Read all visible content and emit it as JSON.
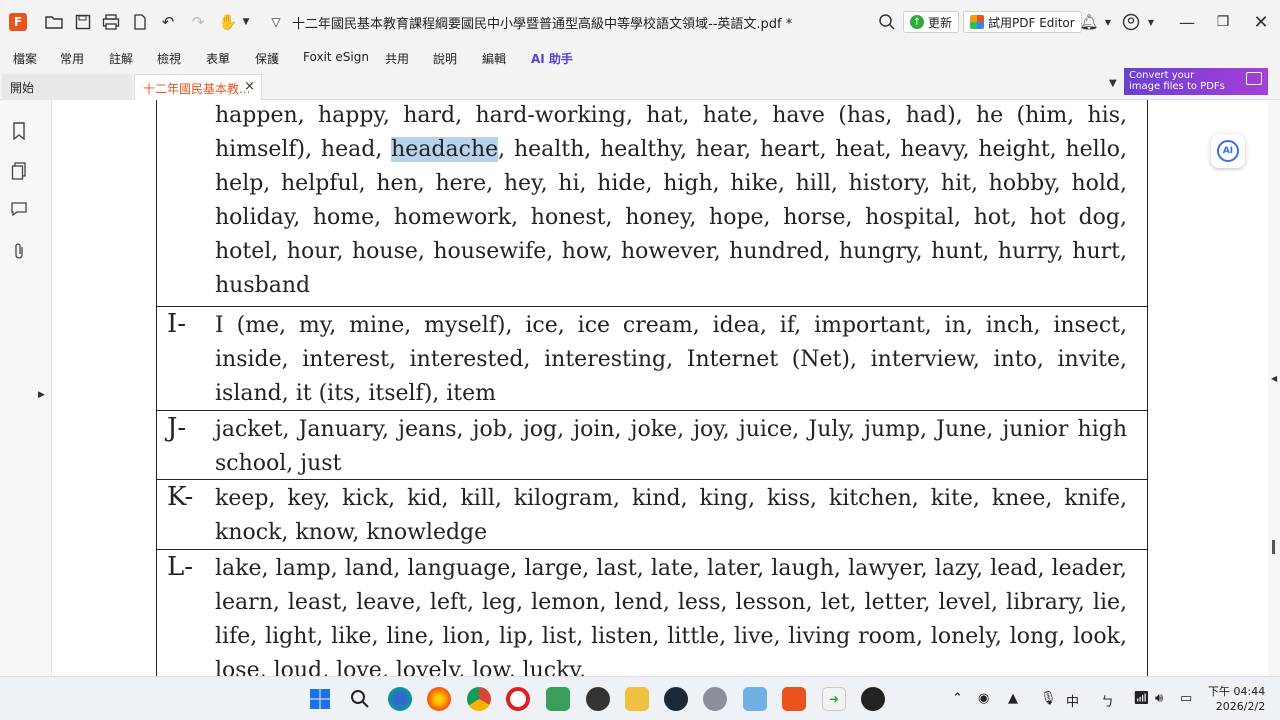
{
  "app": {
    "logo_glyph": "F",
    "document_title": "十二年國民基本教育課程綱要國民中小學暨普通型高級中等學校語文領域--英語文.pdf *",
    "update_label": "更新",
    "try_editor_label": "試用PDF Editor"
  },
  "menu": {
    "items": [
      "檔案",
      "常用",
      "註解",
      "檢視",
      "表單",
      "保護",
      "Foxit eSign",
      "共用",
      "說明",
      "編輯",
      "AI 助手"
    ]
  },
  "tabs": {
    "home_label": "開始",
    "doc_label": "十二年國民基本教...",
    "close_glyph": "×"
  },
  "promo": {
    "line1": "Convert your",
    "line2": "image files to PDFs"
  },
  "vocab": {
    "rows": [
      {
        "letter": "",
        "pre_highlight": "happen, happy, hard, hard-working, hat, hate, have (has, had), he (him, his, himself), head, ",
        "highlight": "headache",
        "post_highlight": ", health, healthy, hear, heart, heat, heavy, height, hello, help, helpful, hen, here, hey, hi, hide, high, hike, hill, history, hit, hobby, hold, holiday, home, homework, honest, honey, hope, horse, hospital, hot, hot dog, hotel, hour, house, housewife, how, however, hundred, hungry, hunt, hurry, hurt, husband"
      },
      {
        "letter": "I-",
        "text": "I (me, my, mine, myself), ice, ice cream, idea, if, important, in, inch, insect, inside, interest, interested, interesting, Internet (Net), interview, into, invite, island, it (its, itself), item"
      },
      {
        "letter": "J-",
        "text": "jacket, January, jeans, job, jog, join, joke, joy, juice, July, jump, June, junior high school, just"
      },
      {
        "letter": "K-",
        "text": "keep, key, kick, kid, kill, kilogram, kind, king, kiss, kitchen, kite, knee, knife, knock, know, knowledge"
      },
      {
        "letter": "L-",
        "text": "lake, lamp, land, language, large, last, late, later, laugh, lawyer, lazy, lead, leader, learn, least, leave, left, leg, lemon, lend, less, lesson, let, letter, level, library, lie, life, light, like, line, lion, lip, list, listen, little, live, living room, lonely, long, look, lose, loud, love, lovely, low, lucky,"
      }
    ]
  },
  "ai_float_label": "AI",
  "taskbar": {
    "ime_label": "中",
    "clock_period_time": "下午 04:44",
    "clock_date": "2026/2/2"
  },
  "colors": {
    "accent": "#e8531e",
    "highlight": "#b7d3ec",
    "ai_purple": "#5b3fd6"
  }
}
